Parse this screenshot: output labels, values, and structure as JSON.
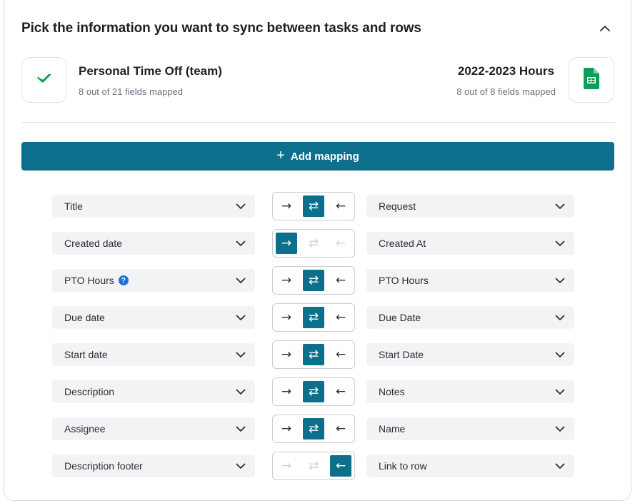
{
  "header": {
    "title": "Pick the information you want to sync between tasks and rows",
    "collapse_icon": "chevron-up-icon"
  },
  "left_app": {
    "name": "Personal Time Off (team)",
    "subtitle": "8 out of 21 fields mapped",
    "icon": "wrike-check-icon",
    "color": "#08a045"
  },
  "right_app": {
    "name": "2022-2023 Hours",
    "subtitle": "8 out of 8 fields mapped",
    "icon": "google-sheets-icon",
    "color": "#0f9d58"
  },
  "add_mapping": {
    "label": "Add mapping",
    "icon": "plus-icon",
    "color": "#0c6f8c"
  },
  "mappings": [
    {
      "left": "Title",
      "right": "Request",
      "direction": "both",
      "help": false
    },
    {
      "left": "Created date",
      "right": "Created At",
      "direction": "to-right",
      "help": false
    },
    {
      "left": "PTO Hours",
      "right": "PTO Hours",
      "direction": "both",
      "help": true
    },
    {
      "left": "Due date",
      "right": "Due Date",
      "direction": "both",
      "help": false
    },
    {
      "left": "Start date",
      "right": "Start Date",
      "direction": "both",
      "help": false
    },
    {
      "left": "Description",
      "right": "Notes",
      "direction": "both",
      "help": false
    },
    {
      "left": "Assignee",
      "right": "Name",
      "direction": "both",
      "help": false
    },
    {
      "left": "Description footer",
      "right": "Link to row",
      "direction": "to-left",
      "help": false
    }
  ],
  "direction_glyphs": {
    "to_right": "→",
    "both": "⇄",
    "to_left": "←"
  },
  "help_glyph": "?"
}
